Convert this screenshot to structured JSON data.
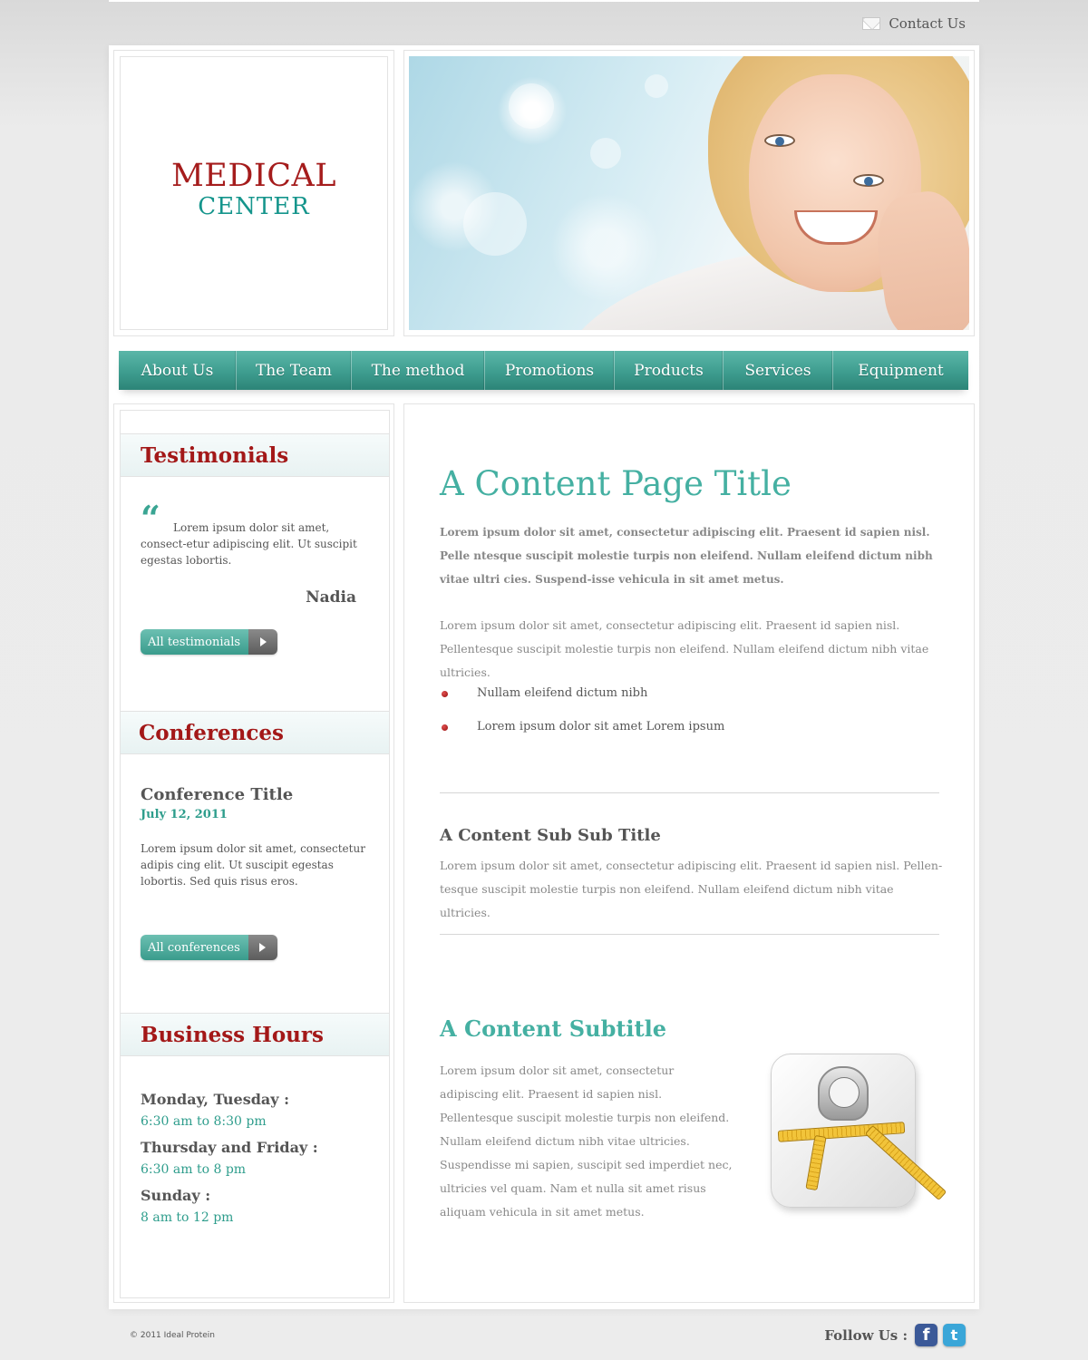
{
  "header": {
    "contact_label": "Contact Us",
    "contact_icon": "envelope-icon"
  },
  "logo": {
    "line1": "MEDICAL",
    "line2": "CENTER"
  },
  "nav": {
    "items": [
      {
        "label": "About Us"
      },
      {
        "label": "The Team"
      },
      {
        "label": "The method"
      },
      {
        "label": "Promotions"
      },
      {
        "label": "Products"
      },
      {
        "label": "Services"
      },
      {
        "label": "Equipment"
      }
    ]
  },
  "sidebar": {
    "testimonials": {
      "heading": "Testimonials",
      "quote_icon": "quote-icon",
      "text": "Lorem ipsum dolor sit amet, consect-etur adipiscing elit. Ut suscipit egestas lobortis.",
      "author": "Nadia",
      "button_label": "All testimonials"
    },
    "conferences": {
      "heading": "Conferences",
      "title": "Conference Title",
      "date": "July 12, 2011",
      "text": "Lorem ipsum dolor sit amet, consectetur adipis cing elit. Ut suscipit egestas lobortis. Sed quis risus eros.",
      "button_label": "All conferences"
    },
    "business_hours": {
      "heading": "Business Hours",
      "entries": [
        {
          "day": "Monday, Tuesday :",
          "time": "6:30 am to 8:30 pm"
        },
        {
          "day": "Thursday and Friday :",
          "time": "6:30 am to 8 pm"
        },
        {
          "day": "Sunday :",
          "time": "8 am to 12 pm"
        }
      ]
    }
  },
  "content": {
    "title": "A Content Page Title",
    "lead": "Lorem ipsum dolor sit amet, consectetur adipiscing elit. Praesent id sapien nisl. Pelle ntesque suscipit molestie turpis non eleifend. Nullam eleifend dictum nibh vitae ultri cies. Suspend-isse vehicula in sit amet metus.",
    "paragraph1": "Lorem ipsum dolor sit amet, consectetur adipiscing elit. Praesent id sapien nisl. Pellentesque suscipit molestie turpis non eleifend. Nullam eleifend dictum nibh vitae ultricies.",
    "bullets": [
      "Nullam eleifend dictum nibh",
      "Lorem ipsum dolor sit amet Lorem ipsum"
    ],
    "sub_sub_title": "A Content Sub Sub Title",
    "paragraph2": "Lorem ipsum dolor sit amet, consectetur adipiscing elit. Praesent id sapien nisl. Pellen-tesque suscipit molestie turpis non eleifend. Nullam eleifend dictum nibh vitae ultricies.",
    "subtitle": "A Content Subtitle",
    "paragraph3": "Lorem ipsum dolor sit amet, consectetur adipiscing elit. Praesent id sapien nisl. Pellentesque suscipit molestie turpis non eleifend. Nullam eleifend dictum nibh vitae ultricies. Suspendisse mi sapien, suscipit sed imperdiet nec, ultricies vel quam. Nam et nulla sit amet risus aliquam vehicula in sit amet metus."
  },
  "footer": {
    "copyright": "© 2011 Ideal Protein",
    "follow_label": "Follow Us :",
    "social": [
      {
        "icon": "facebook-icon",
        "glyph": "f",
        "color": "#3b5998"
      },
      {
        "icon": "twitter-icon",
        "glyph": "t",
        "color": "#3aa6d8"
      }
    ]
  },
  "colors": {
    "accent_teal": "#45b0a2",
    "heading_red": "#a31818",
    "nav_teal": "#3e9d8f"
  }
}
